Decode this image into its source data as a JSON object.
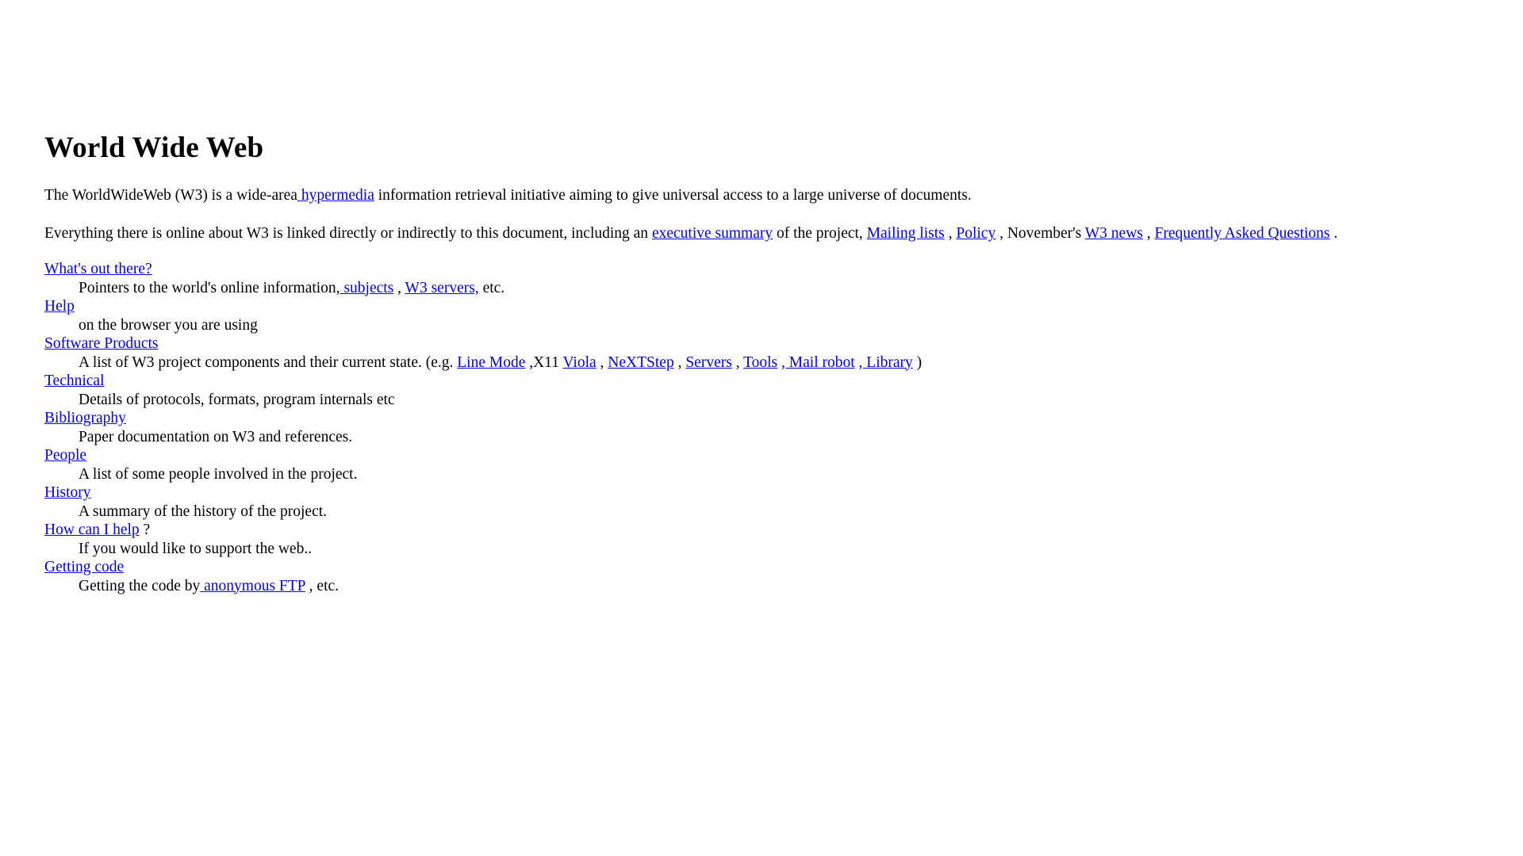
{
  "page": {
    "title": "World Wide Web",
    "background_color": "#ffffff",
    "text_color": "#000000",
    "link_color": "#0000ee"
  },
  "intro": {
    "p1_part1": "The WorldWideWeb (W3) is a wide-area",
    "p1_link_hypermedia": " hypermedia",
    "p1_part2": " information retrieval initiative aiming to give universal access to a large universe of documents.",
    "p2_part1": "Everything there is online about W3 is linked directly or indirectly to this document, including an ",
    "p2_link_executive_summary": "executive summary",
    "p2_part2": " of the project, ",
    "p2_link_mailing_lists": "Mailing lists",
    "p2_part3": " , ",
    "p2_link_policy": "Policy",
    "p2_part4": " , November's ",
    "p2_link_w3_news": "W3 news",
    "p2_part5": " , ",
    "p2_link_faq": "Frequently Asked Questions",
    "p2_part6": " ."
  },
  "entries": [
    {
      "term": "What's out there?",
      "term_is_link": true,
      "def_parts": [
        {
          "text": "Pointers to the world's online information,",
          "link": false
        },
        {
          "text": " subjects",
          "link": true
        },
        {
          "text": " , ",
          "link": false
        },
        {
          "text": "W3 servers,",
          "link": true
        },
        {
          "text": " etc.",
          "link": false
        }
      ]
    },
    {
      "term": "Help",
      "term_is_link": true,
      "def_parts": [
        {
          "text": "on the browser you are using",
          "link": false
        }
      ]
    },
    {
      "term": "Software Products",
      "term_is_link": true,
      "def_parts": [
        {
          "text": "A list of W3 project components and their current state. (e.g. ",
          "link": false
        },
        {
          "text": "Line Mode",
          "link": true
        },
        {
          "text": " ,X11 ",
          "link": false
        },
        {
          "text": "Viola",
          "link": true
        },
        {
          "text": " , ",
          "link": false
        },
        {
          "text": "NeXTStep",
          "link": true
        },
        {
          "text": " , ",
          "link": false
        },
        {
          "text": "Servers",
          "link": true
        },
        {
          "text": " , ",
          "link": false
        },
        {
          "text": "Tools",
          "link": true
        },
        {
          "text": " ",
          "link": false
        },
        {
          "text": ", Mail robot",
          "link": true
        },
        {
          "text": " ",
          "link": false
        },
        {
          "text": ", Library",
          "link": true
        },
        {
          "text": " )",
          "link": false
        }
      ]
    },
    {
      "term": "Technical",
      "term_is_link": true,
      "def_parts": [
        {
          "text": "Details of protocols, formats, program internals etc",
          "link": false
        }
      ]
    },
    {
      "term": "Bibliography",
      "term_is_link": true,
      "def_parts": [
        {
          "text": "Paper documentation on W3 and references.",
          "link": false
        }
      ]
    },
    {
      "term": "People",
      "term_is_link": true,
      "def_parts": [
        {
          "text": "A list of some people involved in the project.",
          "link": false
        }
      ]
    },
    {
      "term": "History",
      "term_is_link": true,
      "def_parts": [
        {
          "text": "A summary of the history of the project.",
          "link": false
        }
      ]
    },
    {
      "term": "How can I help",
      "term_is_link": true,
      "term_suffix": " ?",
      "def_parts": [
        {
          "text": "If you would like to support the web..",
          "link": false
        }
      ]
    },
    {
      "term": "Getting code",
      "term_is_link": true,
      "def_parts": [
        {
          "text": "Getting the code by",
          "link": false
        },
        {
          "text": " anonymous FTP",
          "link": true
        },
        {
          "text": " , etc.",
          "link": false
        }
      ]
    }
  ]
}
